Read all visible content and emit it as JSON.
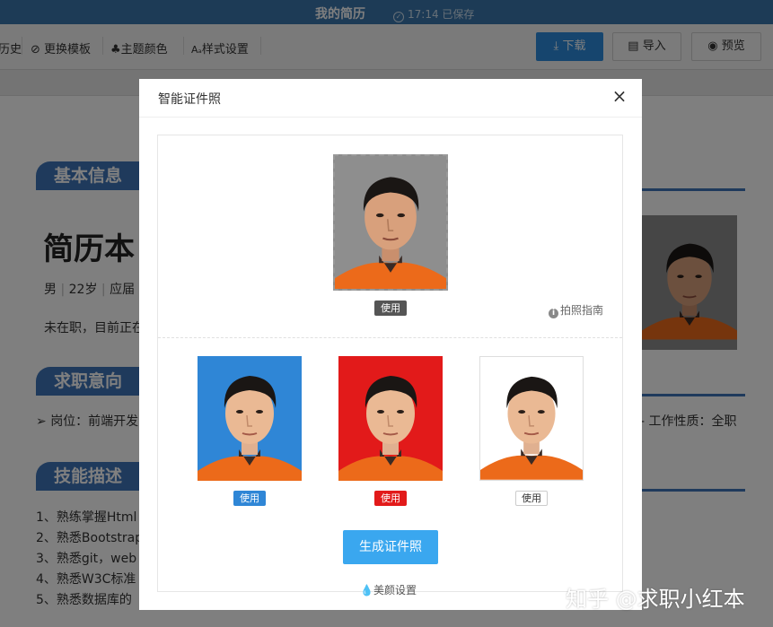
{
  "window": {
    "title": "我的简历",
    "saved": "17:14 已保存"
  },
  "toolbar": {
    "history": "历史",
    "template": "更换模板",
    "theme": "主题颜色",
    "style": "样式设置",
    "download": "下载",
    "import": "导入",
    "preview": "预览"
  },
  "resume": {
    "sections": [
      "基本信息",
      "求职意向",
      "技能描述"
    ],
    "name": "简历本",
    "info_items": [
      "男",
      "22岁",
      "应届"
    ],
    "status": "未在职，目前正在",
    "position": "岗位：前端开发",
    "work_type": "工作性质：全职",
    "skills": [
      "1、熟练掌握Html",
      "2、熟悉Bootstrap",
      "3、熟悉git，web",
      "4、熟悉W3C标准",
      "5、熟悉数据库的"
    ]
  },
  "modal": {
    "title": "智能证件照",
    "close": "×",
    "use_label": "使用",
    "guide": "拍照指南",
    "generate": "生成证件照",
    "beauty": "美颜设置"
  },
  "colors": {
    "accent_blue": "#2c8bdc",
    "photo_blue": "#2f86d6",
    "photo_red": "#e21a1a",
    "section_blue": "#3f74b8",
    "generate_button": "#3aa7ef"
  },
  "watermark": "知乎 @求职小红本"
}
